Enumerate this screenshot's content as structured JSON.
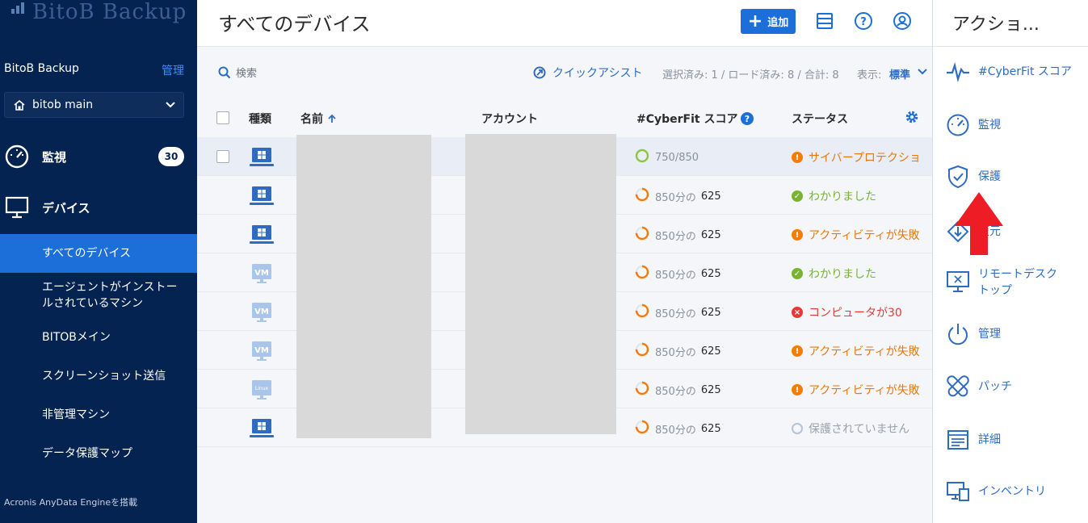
{
  "sidebar": {
    "logo_text": "BitoB Backup",
    "tenant_name": "BitoB Backup",
    "manage_link": "管理",
    "tenant_select": "bitob main",
    "monitor": {
      "label": "監視",
      "badge": "30"
    },
    "devices": {
      "label": "デバイス"
    },
    "items": [
      {
        "label": "すべてのデバイス",
        "active": true
      },
      {
        "label": "エージェントがインストールされているマシン",
        "active": false
      },
      {
        "label": "BITOBメイン",
        "active": false
      },
      {
        "label": "スクリーンショット送信",
        "active": false
      },
      {
        "label": "非管理マシン",
        "active": false
      },
      {
        "label": "データ保護マップ",
        "active": false
      }
    ],
    "footer": "Acronis AnyData Engineを搭載"
  },
  "header": {
    "title": "すべてのデバイス",
    "add_label": "追加"
  },
  "toolbar": {
    "search_placeholder": "検索",
    "quick_assist": "クイックアシスト",
    "selection_info": "選択済み: 1 / ロード済み: 8 / 合計: 8",
    "view_label": "表示:",
    "view_value": "標準"
  },
  "table": {
    "columns": {
      "type": "種類",
      "name": "名前",
      "account": "アカウント",
      "score": "#CyberFit スコア",
      "status": "ステータス"
    },
    "rows": [
      {
        "type": "windows",
        "score_text": "750/850",
        "score_num": "",
        "status": "サイバープロテクション",
        "status_kind": "warn",
        "selected": true
      },
      {
        "type": "windows",
        "score_text": "850分の",
        "score_num": "625",
        "status": "わかりました",
        "status_kind": "ok",
        "selected": false
      },
      {
        "type": "windows",
        "score_text": "850分の",
        "score_num": "625",
        "status": "アクティビティが失敗",
        "status_kind": "warn",
        "selected": false
      },
      {
        "type": "vm",
        "score_text": "850分の",
        "score_num": "625",
        "status": "わかりました",
        "status_kind": "ok",
        "selected": false
      },
      {
        "type": "vm",
        "score_text": "850分の",
        "score_num": "625",
        "status": "コンピュータが30",
        "status_kind": "err",
        "selected": false
      },
      {
        "type": "vm",
        "score_text": "850分の",
        "score_num": "625",
        "status": "アクティビティが失敗",
        "status_kind": "warn",
        "selected": false
      },
      {
        "type": "linux",
        "score_text": "850分の",
        "score_num": "625",
        "status": "アクティビティが失敗",
        "status_kind": "warn",
        "selected": false
      },
      {
        "type": "windows",
        "score_text": "850分の",
        "score_num": "625",
        "status": "保護されていません",
        "status_kind": "none",
        "selected": false
      }
    ],
    "vm_label": "VM",
    "linux_label": "Linux"
  },
  "actions": {
    "title": "アクショ...",
    "items": [
      {
        "label": "#CyberFit スコア",
        "icon": "pulse-icon"
      },
      {
        "label": "監視",
        "icon": "gauge-icon"
      },
      {
        "label": "保護",
        "icon": "shield-icon"
      },
      {
        "label": "復元",
        "icon": "restore-icon"
      },
      {
        "label": "リモートデスクトップ",
        "icon": "remote-desktop-icon"
      },
      {
        "label": "管理",
        "icon": "power-icon"
      },
      {
        "label": "パッチ",
        "icon": "patch-icon"
      },
      {
        "label": "詳細",
        "icon": "details-icon"
      },
      {
        "label": "インベントリ",
        "icon": "inventory-icon"
      }
    ]
  },
  "colors": {
    "sidebar_bg": "#042350",
    "accent": "#1c6fd9",
    "warn": "#f57c00",
    "ok": "#7ab32e",
    "error": "#e53935"
  }
}
